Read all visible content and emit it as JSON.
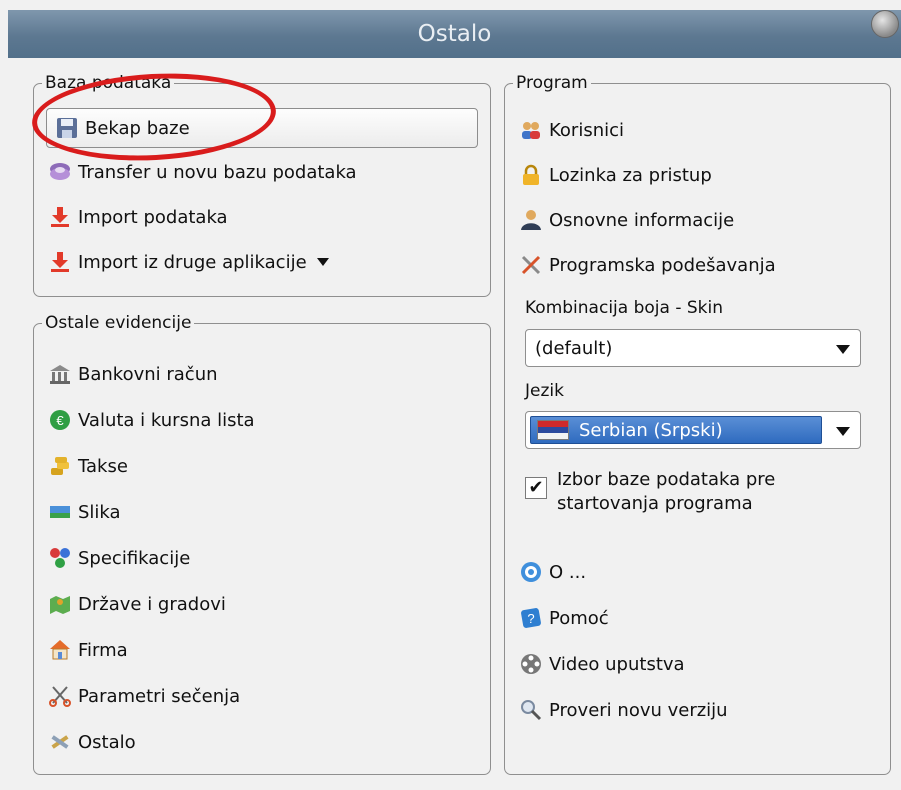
{
  "window": {
    "title": "Ostalo"
  },
  "groups": {
    "baza": {
      "legend": "Baza podataka",
      "items": [
        "Bekap baze",
        "Transfer u novu bazu podataka",
        "Import podataka",
        "Import iz druge aplikacije"
      ]
    },
    "ostale": {
      "legend": "Ostale evidencije",
      "items": [
        "Bankovni račun",
        "Valuta i kursna lista",
        "Takse",
        "Slika",
        "Specifikacije",
        "Države i gradovi",
        "Firma",
        "Parametri sečenja",
        "Ostalo"
      ]
    },
    "program": {
      "legend": "Program",
      "items": [
        "Korisnici",
        "Lozinka za pristup",
        "Osnovne informacije",
        "Programska podešavanja"
      ],
      "skin_label": "Kombinacija boja - Skin",
      "skin_value": "(default)",
      "lang_label": "Jezik",
      "lang_value": "Serbian (Srpski)",
      "checkbox_label_1": "Izbor baze podataka pre",
      "checkbox_label_2": "startovanja programa",
      "checkbox_checked": true,
      "bottom_items": [
        "O ...",
        "Pomoć",
        "Video uputstva",
        "Proveri novu verziju"
      ]
    }
  },
  "annotation_color": "#d91c1c"
}
